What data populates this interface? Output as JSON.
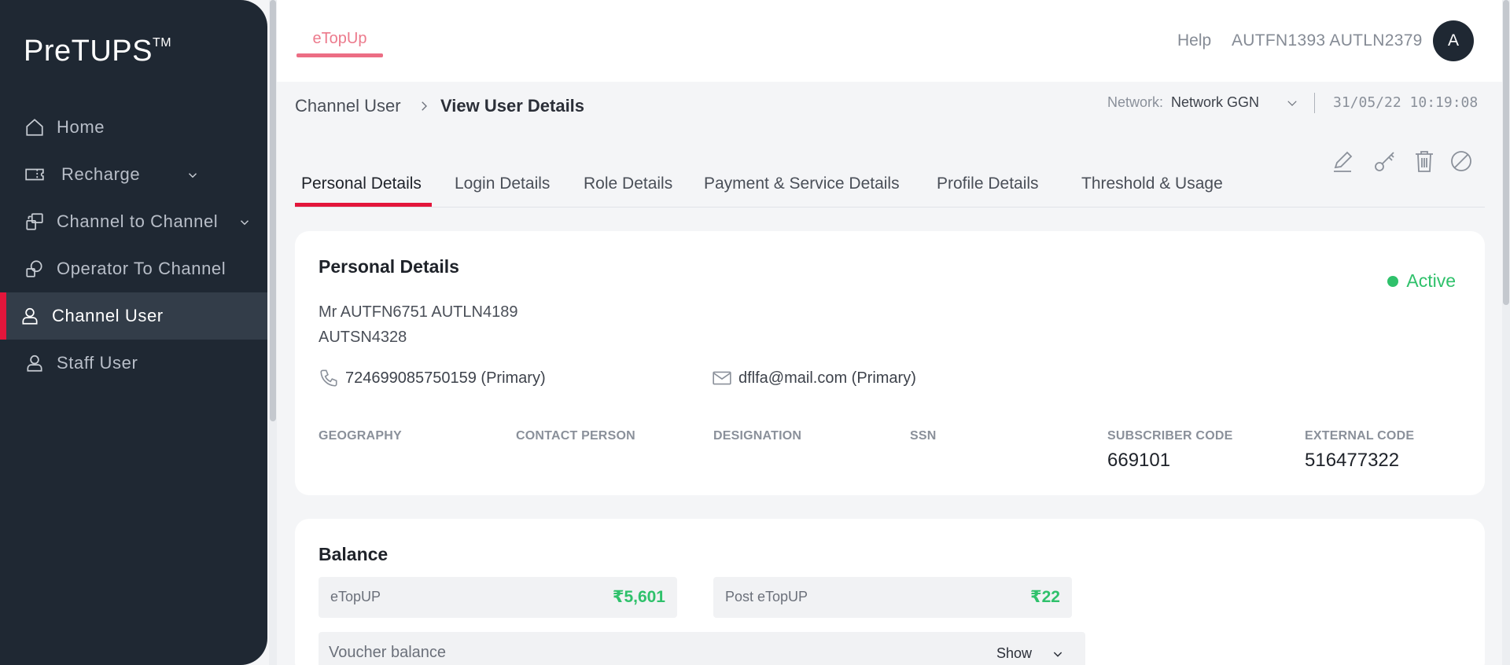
{
  "sidebar": {
    "logo": "PreTUPS",
    "logo_tm": "TM",
    "items": [
      {
        "label": "Home",
        "icon": "home-icon"
      },
      {
        "label": "Recharge",
        "icon": "recharge-icon",
        "has_submenu": true
      },
      {
        "label": "Channel to Channel",
        "icon": "channel-to-channel-icon",
        "has_submenu": true
      },
      {
        "label": "Operator To Channel",
        "icon": "operator-to-channel-icon"
      },
      {
        "label": "Channel User",
        "icon": "user-icon",
        "active": true
      },
      {
        "label": "Staff User",
        "icon": "user-icon"
      }
    ]
  },
  "header": {
    "app_tab": "eTopUp",
    "help": "Help",
    "username": "AUTFN1393 AUTLN2379",
    "avatar_initial": "A"
  },
  "breadcrumb": {
    "parent": "Channel User",
    "current": "View User Details"
  },
  "network": {
    "label": "Network:",
    "value": "Network GGN",
    "datetime": "31/05/22 10:19:08"
  },
  "tabs": [
    {
      "label": "Personal Details",
      "active": true
    },
    {
      "label": "Login Details"
    },
    {
      "label": "Role Details"
    },
    {
      "label": "Payment & Service Details"
    },
    {
      "label": "Profile Details"
    },
    {
      "label": "Threshold & Usage"
    }
  ],
  "actions": [
    "edit-icon",
    "key-icon",
    "delete-icon",
    "block-icon"
  ],
  "personal": {
    "title": "Personal Details",
    "status": "Active",
    "full_name": "Mr AUTFN6751 AUTLN4189",
    "short_name": "AUTSN4328",
    "phone": "724699085750159 (Primary)",
    "email": "dflfa@mail.com (Primary)",
    "fields": [
      {
        "label": "GEOGRAPHY",
        "value": ""
      },
      {
        "label": "CONTACT PERSON",
        "value": ""
      },
      {
        "label": "DESIGNATION",
        "value": ""
      },
      {
        "label": "SSN",
        "value": ""
      },
      {
        "label": "SUBSCRIBER CODE",
        "value": "669101"
      },
      {
        "label": "EXTERNAL CODE",
        "value": "516477322"
      }
    ]
  },
  "balance": {
    "title": "Balance",
    "items": [
      {
        "label": "eTopUP",
        "value": "₹5,601"
      },
      {
        "label": "Post eTopUP",
        "value": "₹22"
      }
    ],
    "voucher_label": "Voucher balance",
    "voucher_action": "Show"
  },
  "colors": {
    "sidebar_bg": "#1f2833",
    "accent_red": "#e3163b",
    "status_green": "#2fc16b"
  }
}
